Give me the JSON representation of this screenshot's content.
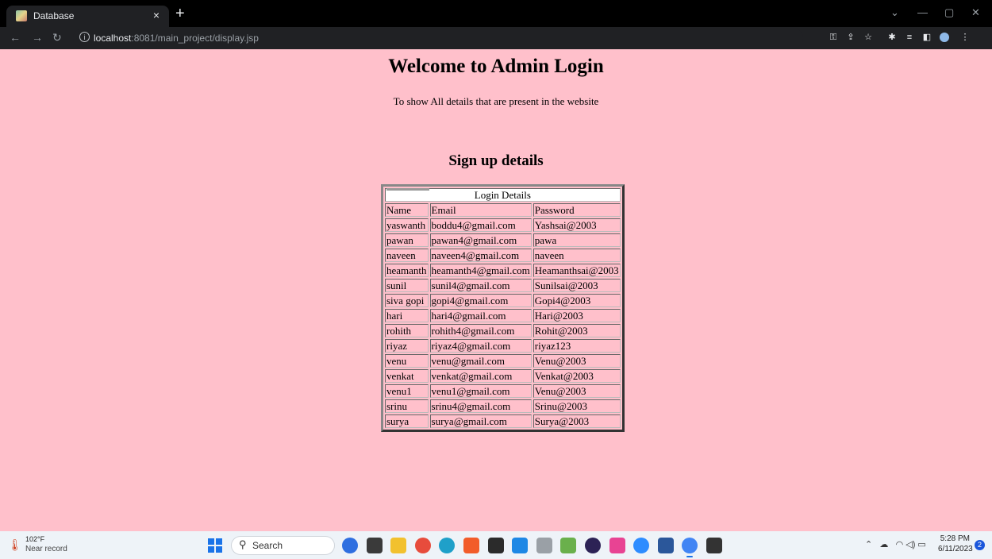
{
  "browser": {
    "tab_title": "Database",
    "tab_close": "×",
    "new_tab": "+",
    "url_host": "localhost",
    "url_rest": ":8081/main_project/display.jsp"
  },
  "page": {
    "heading": "Welcome to Admin Login",
    "subtitle": "To show All details that are present in the website",
    "section_heading": "Sign up details",
    "table_caption": "Login Details",
    "columns": [
      "Name",
      "Email",
      "Password"
    ],
    "rows": [
      [
        "yaswanth",
        "boddu4@gmail.com",
        "Yashsai@2003"
      ],
      [
        "pawan",
        "pawan4@gmail.com",
        "pawa"
      ],
      [
        "naveen",
        "naveen4@gmail.com",
        "naveen"
      ],
      [
        "heamanth",
        "heamanth4@gmail.com",
        "Heamanthsai@2003"
      ],
      [
        "sunil",
        "sunil4@gmail.com",
        "Sunilsai@2003"
      ],
      [
        "siva gopi",
        "gopi4@gmail.com",
        "Gopi4@2003"
      ],
      [
        "hari",
        "hari4@gmail.com",
        "Hari@2003"
      ],
      [
        "rohith",
        "rohith4@gmail.com",
        "Rohit@2003"
      ],
      [
        "riyaz",
        "riyaz4@gmail.com",
        "riyaz123"
      ],
      [
        "venu",
        "venu@gmail.com",
        "Venu@2003"
      ],
      [
        "venkat",
        "venkat@gmail.com",
        "Venkat@2003"
      ],
      [
        "venu1",
        "venu1@gmail.com",
        "Venu@2003"
      ],
      [
        "srinu",
        "srinu4@gmail.com",
        "Srinu@2003"
      ],
      [
        "surya",
        "surya@gmail.com",
        "Surya@2003"
      ]
    ]
  },
  "taskbar": {
    "weather_temp": "102°F",
    "weather_status": "Near record",
    "search_label": "Search",
    "time": "5:28 PM",
    "date": "6/11/2023",
    "notification_count": "2",
    "apps": [
      {
        "name": "bing-app",
        "color": "#2f6fe0"
      },
      {
        "name": "task-view-app",
        "color": "#3a3a3a"
      },
      {
        "name": "file-explorer-app",
        "color": "#f2c12e"
      },
      {
        "name": "chrome-app",
        "color": "#e74c3c"
      },
      {
        "name": "edge-app",
        "color": "#1fa0c9"
      },
      {
        "name": "brave-app",
        "color": "#f25c2a"
      },
      {
        "name": "pycharm-app",
        "color": "#2b2b2b"
      },
      {
        "name": "vscode-app",
        "color": "#1e88e5"
      },
      {
        "name": "database-app",
        "color": "#9aa0a6"
      },
      {
        "name": "photos-app",
        "color": "#6ab04c"
      },
      {
        "name": "eclipse-app",
        "color": "#2c2255"
      },
      {
        "name": "store-app",
        "color": "#e84393"
      },
      {
        "name": "zoom-app",
        "color": "#2d8cff"
      },
      {
        "name": "word-app",
        "color": "#2b579a"
      },
      {
        "name": "chrome-dev-app",
        "color": "#4285f4"
      },
      {
        "name": "terminal-app",
        "color": "#333333"
      }
    ]
  }
}
